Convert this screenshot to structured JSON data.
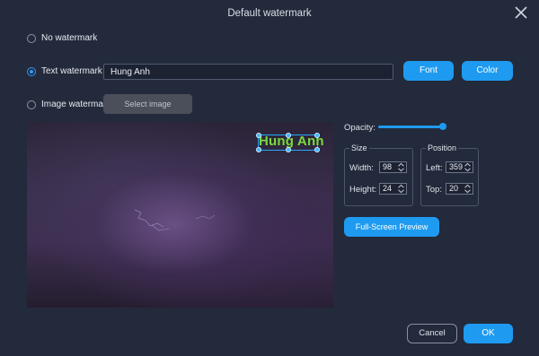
{
  "window": {
    "title": "Default watermark"
  },
  "options": {
    "no_watermark": "No watermark",
    "text_watermark": "Text watermark",
    "image_watermark": "Image watermark",
    "selected": "text_watermark"
  },
  "text_input": {
    "value": "Hung Anh"
  },
  "buttons": {
    "font": "Font",
    "color": "Color",
    "select_image": "Select image",
    "full_screen_preview": "Full-Screen Preview",
    "cancel": "Cancel",
    "ok": "OK"
  },
  "preview": {
    "watermark_text": "Hung Anh",
    "watermark_color": "#7dd642"
  },
  "opacity": {
    "label": "Opacity:",
    "value_percent": 100
  },
  "size": {
    "title": "Size",
    "width_label": "Width:",
    "width_value": "98",
    "height_label": "Height:",
    "height_value": "24"
  },
  "position": {
    "title": "Position",
    "left_label": "Left:",
    "left_value": "359",
    "top_label": "Top:",
    "top_value": "20"
  },
  "colors": {
    "accent": "#1e9bf0",
    "background": "#232a3b"
  },
  "icons": {
    "close": "close-icon",
    "spin": "spin-arrows-icon"
  }
}
